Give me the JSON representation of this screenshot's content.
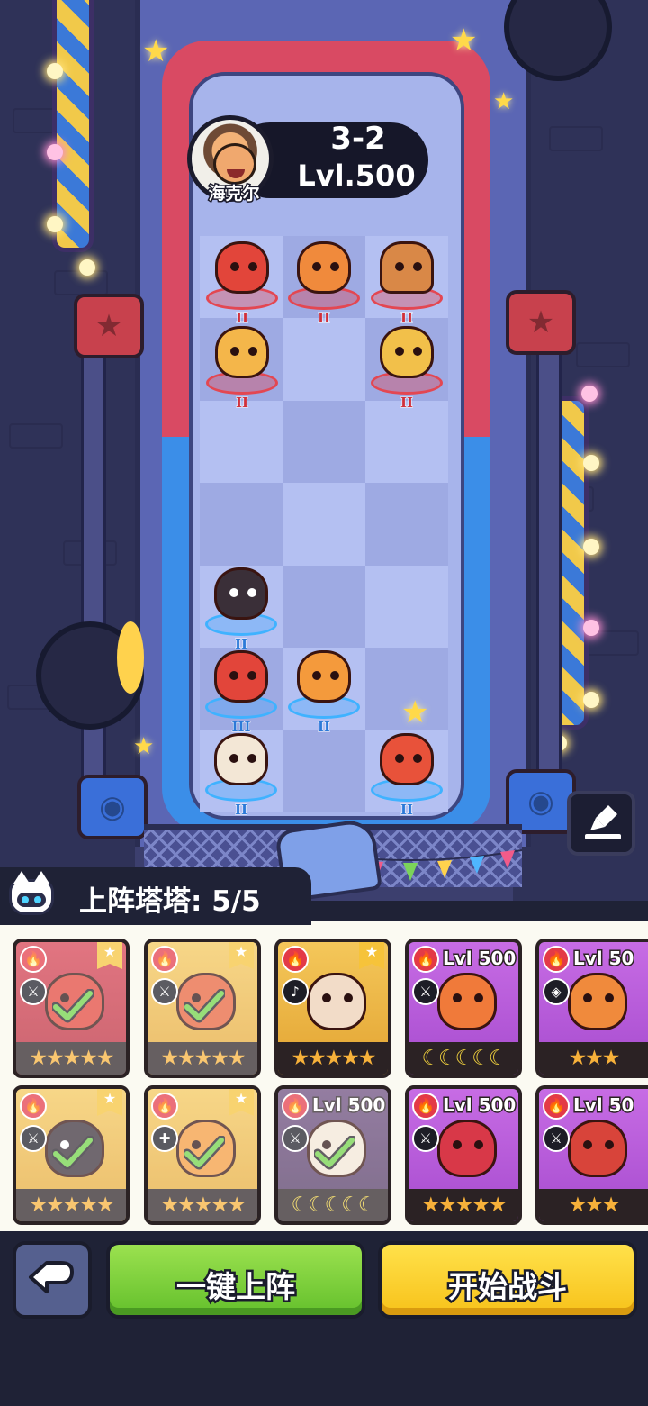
{
  "opponent": {
    "name": "海克尔",
    "stage": "3-2",
    "level": "Lvl.500"
  },
  "field": {
    "enemy_units": [
      {
        "id": "enemy-fire-dragon",
        "rank": "II",
        "color": "#e2453a"
      },
      {
        "id": "enemy-tiger",
        "rank": "II",
        "color": "#f08a3c"
      },
      {
        "id": "enemy-burger-pig",
        "rank": "II",
        "color": "#d98847"
      },
      {
        "id": "enemy-fire-lynx",
        "rank": "II",
        "color": "#f4b64a"
      },
      {
        "id": "enemy-lion",
        "rank": "II",
        "color": "#f2c04a"
      }
    ],
    "ally_units": [
      {
        "id": "ally-fire-dogs",
        "rank": "II",
        "color": "#3a2f38"
      },
      {
        "id": "ally-fire-dragon",
        "rank": "III",
        "color": "#e2453a"
      },
      {
        "id": "ally-fire-rabbit",
        "rank": "II",
        "color": "#f49a3c"
      },
      {
        "id": "ally-fire-phoenix",
        "rank": "II",
        "color": "#f3e7d6"
      },
      {
        "id": "ally-red-fox",
        "rank": "II",
        "color": "#e8523a"
      }
    ]
  },
  "deploy": {
    "label": "上阵塔塔: 5/5"
  },
  "cards": [
    {
      "name": "fire-dragon-card",
      "level": "",
      "deployed": true,
      "stars": "★★★★★",
      "creature_color": "#e2453a"
    },
    {
      "name": "fire-fox-card",
      "level": "",
      "deployed": true,
      "stars": "★★★★★",
      "creature_color": "#e8623a"
    },
    {
      "name": "fire-frog-card",
      "level": "",
      "deployed": false,
      "stars": "★★★★★",
      "creature_color": "#f2dcc8"
    },
    {
      "name": "fire-ferret-card",
      "level": "Lvl 500",
      "deployed": false,
      "stars": "☾☾☾☾☾",
      "creature_color": "#f07a3a"
    },
    {
      "name": "tiger-card",
      "level": "Lvl 50",
      "deployed": false,
      "stars": "★★★",
      "creature_color": "#f08a3c"
    },
    {
      "name": "fire-dogs-card",
      "level": "",
      "deployed": true,
      "stars": "★★★★★",
      "creature_color": "#3a2f38"
    },
    {
      "name": "fire-rabbit-card",
      "level": "",
      "deployed": true,
      "stars": "★★★★★",
      "creature_color": "#f49a3c"
    },
    {
      "name": "fire-phoenix-card",
      "level": "Lvl 500",
      "deployed": true,
      "stars": "☾☾☾☾☾",
      "creature_color": "#f3e7d6"
    },
    {
      "name": "red-mole-card",
      "level": "Lvl 500",
      "deployed": false,
      "stars": "★★★★★",
      "creature_color": "#d83848"
    },
    {
      "name": "red-bird-card",
      "level": "Lvl 50",
      "deployed": false,
      "stars": "★★★",
      "creature_color": "#d8443a"
    }
  ],
  "actions": {
    "auto_deploy": "一键上阵",
    "start_battle": "开始战斗"
  },
  "icons": {
    "save": "download-icon",
    "back": "return-arrow-icon",
    "element": "fire-icon"
  }
}
